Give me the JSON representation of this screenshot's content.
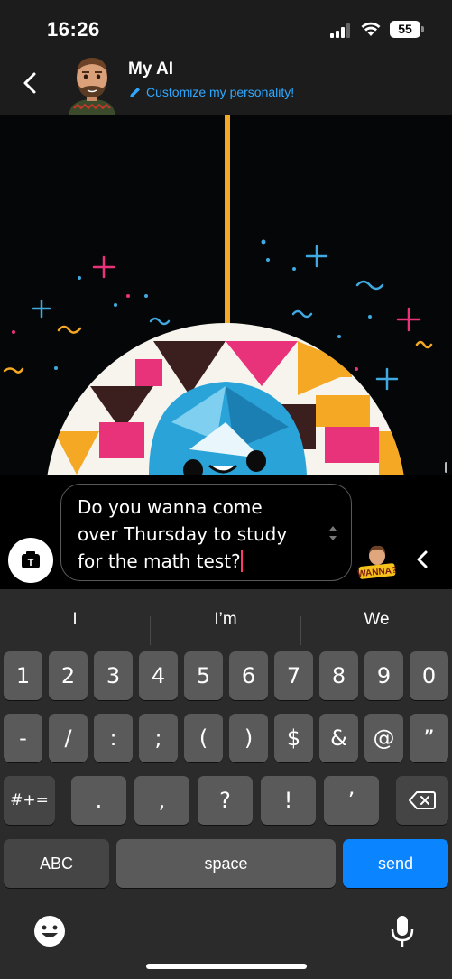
{
  "status_bar": {
    "time": "16:26",
    "battery": "55"
  },
  "header": {
    "title": "My AI",
    "subtitle": "Customize my personality!"
  },
  "composer": {
    "message_lines": [
      "Do you wanna come",
      "over Thursday to study",
      "for the math test?"
    ],
    "sticker_text": "WANNA?"
  },
  "keyboard": {
    "suggestions": [
      "I",
      "I’m",
      "We"
    ],
    "row1": [
      "1",
      "2",
      "3",
      "4",
      "5",
      "6",
      "7",
      "8",
      "9",
      "0"
    ],
    "row2": [
      "-",
      "/",
      ":",
      ";",
      "(",
      ")",
      "$",
      "&",
      "@",
      "”"
    ],
    "row3_mode": "#+=",
    "row3": [
      ".",
      ",",
      "?",
      "!",
      "’"
    ],
    "abc": "ABC",
    "space": "space",
    "send": "send"
  },
  "colors": {
    "accent": "#2ea8ff",
    "send": "#0a84ff",
    "caret": "#ff3b6b"
  }
}
